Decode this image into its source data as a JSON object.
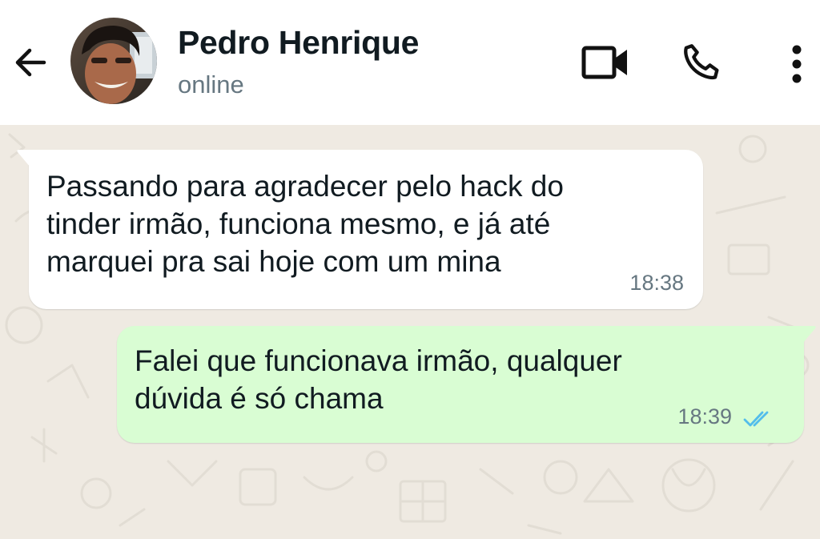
{
  "header": {
    "contact_name": "Pedro Henrique",
    "status": "online",
    "icons": {
      "back": "arrow-left-icon",
      "video": "video-camera-icon",
      "call": "phone-icon",
      "menu": "more-vertical-icon"
    }
  },
  "messages": [
    {
      "direction": "incoming",
      "text": "Passando para agradecer pelo hack do\ntinder irmão, funciona mesmo, e já até\nmarquei pra sai hoje com um mina",
      "time": "18:38"
    },
    {
      "direction": "outgoing",
      "text": "Falei que funcionava irmão, qualquer\ndúvida é só chama",
      "time": "18:39",
      "status_icon": "double-check-read-icon"
    }
  ],
  "colors": {
    "chat_background": "#efeae2",
    "incoming_bubble": "#ffffff",
    "outgoing_bubble": "#d9fdd3",
    "read_tick": "#53bdeb",
    "timestamp": "#667781",
    "primary_text": "#111b21"
  }
}
